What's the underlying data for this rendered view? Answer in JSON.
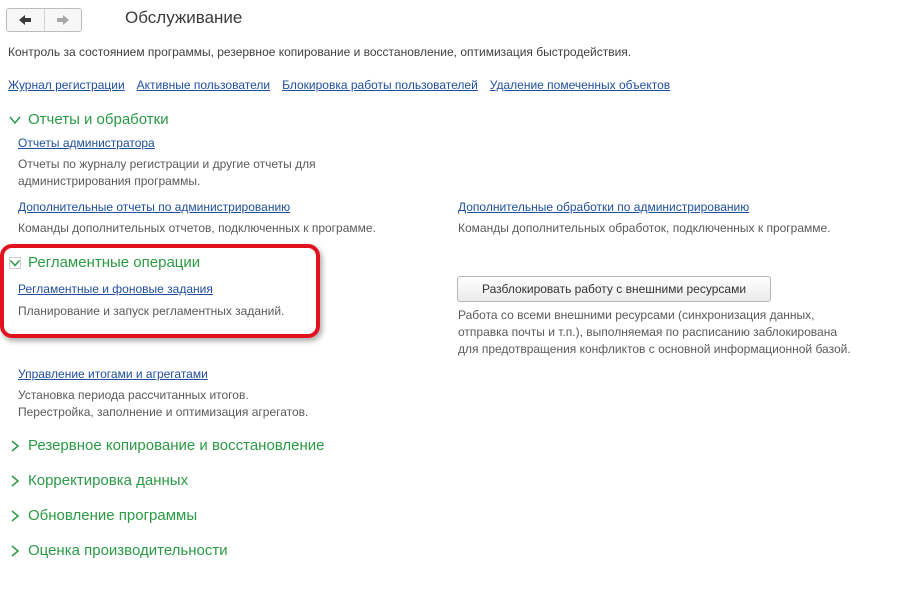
{
  "header": {
    "title": "Обслуживание",
    "back_icon": "arrow-left-icon",
    "forward_icon": "arrow-right-icon"
  },
  "description": "Контроль за состоянием программы, резервное копирование и восстановление, оптимизация быстродействия.",
  "top_links": [
    "Журнал регистрации",
    "Активные пользователи",
    "Блокировка работы пользователей",
    "Удаление помеченных объектов"
  ],
  "reports_group": {
    "title": "Отчеты и обработки",
    "admin_reports_link": "Отчеты администратора",
    "admin_reports_note": [
      "Отчеты по журналу регистрации и другие отчеты для",
      "администрирования программы."
    ],
    "extra_reports_link": "Дополнительные отчеты по администрированию",
    "extra_reports_note": "Команды дополнительных отчетов, подключенных к программе.",
    "extra_processing_link": "Дополнительные обработки по администрированию",
    "extra_processing_note": "Команды дополнительных обработок, подключенных к программе."
  },
  "scheduled_group": {
    "title": "Регламентные операции",
    "jobs_link": "Регламентные и фоновые задания",
    "jobs_note": "Планирование и запуск регламентных заданий.",
    "unlock_button": "Разблокировать работу с внешними ресурсами",
    "unlock_note": [
      "Работа со всеми внешними ресурсами (синхронизация данных,",
      "отправка почты и т.п.), выполняемая по расписанию заблокирована",
      "для предотвращения конфликтов с основной информационной базой."
    ],
    "totals_link": "Управление итогами и агрегатами",
    "totals_note": [
      "Установка периода рассчитанных итогов.",
      "Перестройка, заполнение и оптимизация агрегатов."
    ]
  },
  "collapsed_groups": [
    "Резервное копирование и восстановление",
    "Корректировка данных",
    "Обновление программы",
    "Оценка производительности"
  ],
  "colors": {
    "group_title": "#2b9a45",
    "link": "#1f4e9e",
    "highlight": "#e2111e"
  }
}
